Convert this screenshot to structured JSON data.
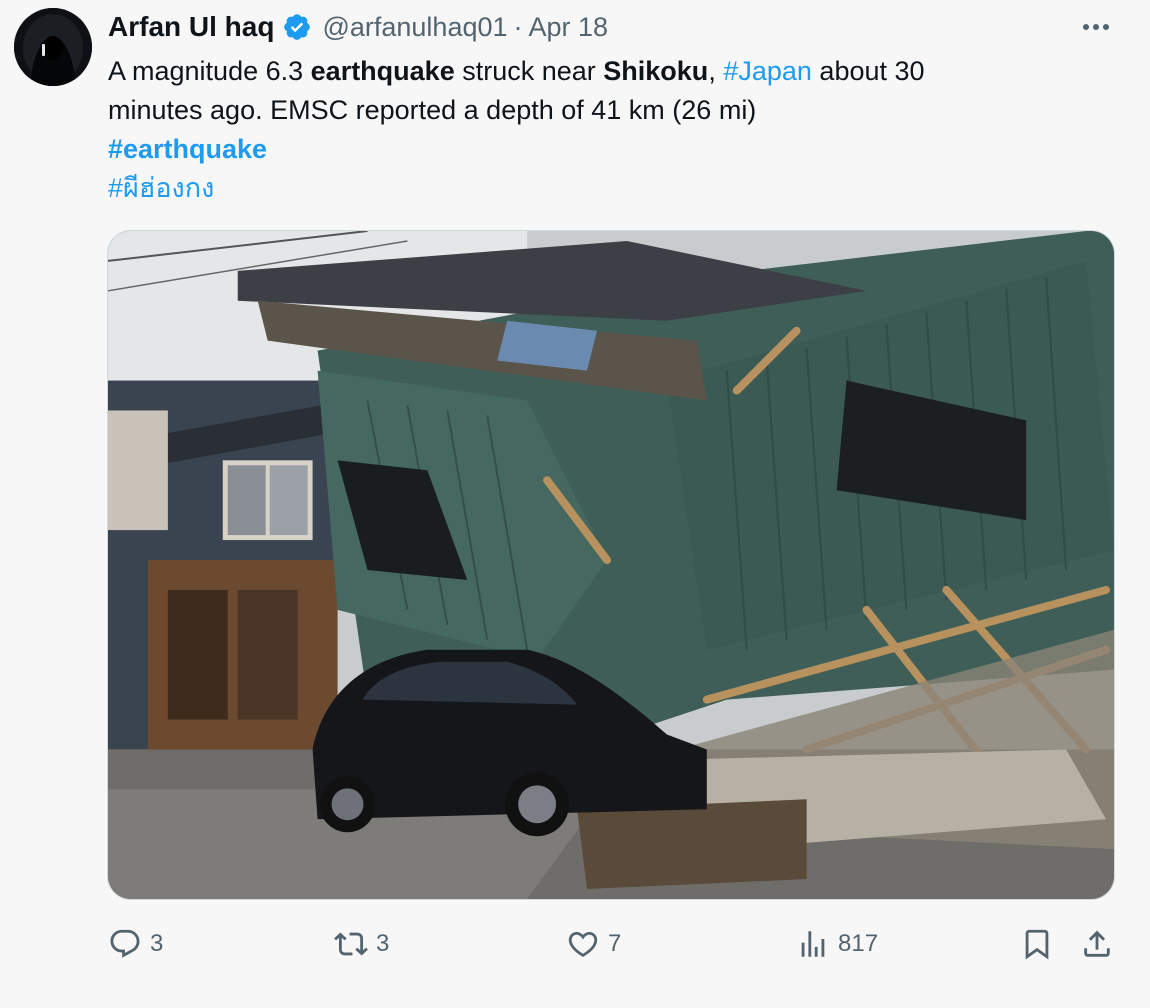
{
  "tweet": {
    "author": {
      "display_name": "Arfan Ul haq",
      "handle": "@arfanulhaq01",
      "separator": "·",
      "date": "Apr 18"
    },
    "text": {
      "l1_a": "A magnitude 6.3 ",
      "l1_b": "earthquake",
      "l1_c": " struck near ",
      "l1_d": "Shikoku",
      "l1_e": ", ",
      "l1_f": "#Japan",
      "l1_g": " about 30",
      "l2": "minutes ago. EMSC reported a depth of 41 km (26 mi)",
      "hashtag1": "#earthquake",
      "hashtag2": "#ผีฮ่องกง"
    },
    "colors": {
      "link": "#1d9bf0",
      "verified_badge": "#1d9bf0",
      "muted": "#536471"
    }
  },
  "actions": {
    "reply_count": "3",
    "retweet_count": "3",
    "like_count": "7",
    "views_count": "817",
    "icons": [
      "reply-icon",
      "retweet-icon",
      "like-icon",
      "views-icon",
      "bookmark-icon",
      "share-icon"
    ]
  }
}
